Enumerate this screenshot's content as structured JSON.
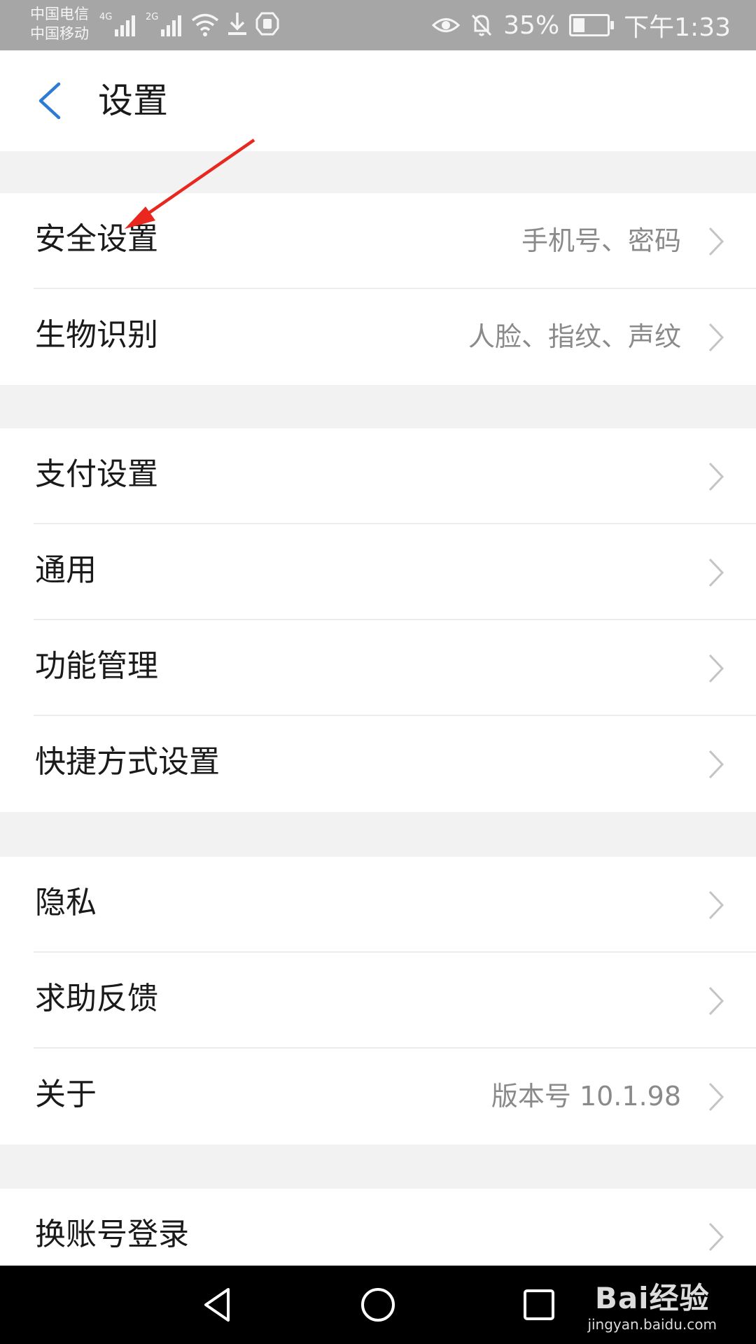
{
  "status_bar": {
    "carrier1": "中国电信",
    "carrier2": "中国移动",
    "net1": "4G",
    "net2": "2G",
    "battery": "35%",
    "battery_level": 0.35,
    "time": "下午1:33",
    "icons": [
      "signal-icon",
      "signal-icon",
      "wifi-icon",
      "download-icon",
      "shield-icon",
      "eye-icon",
      "mute-bell-icon",
      "battery-icon"
    ]
  },
  "header": {
    "title": "设置",
    "back_icon": "back-arrow-icon"
  },
  "groups": [
    {
      "items": [
        {
          "label": "安全设置",
          "value": "手机号、密码"
        },
        {
          "label": "生物识别",
          "value": "人脸、指纹、声纹"
        }
      ]
    },
    {
      "items": [
        {
          "label": "支付设置",
          "value": ""
        },
        {
          "label": "通用",
          "value": ""
        },
        {
          "label": "功能管理",
          "value": ""
        },
        {
          "label": "快捷方式设置",
          "value": ""
        }
      ]
    },
    {
      "items": [
        {
          "label": "隐私",
          "value": ""
        },
        {
          "label": "求助反馈",
          "value": ""
        },
        {
          "label": "关于",
          "value": "版本号 10.1.98"
        }
      ]
    },
    {
      "items": [
        {
          "label": "换账号登录",
          "value": ""
        }
      ]
    }
  ],
  "nav_bar": {
    "buttons": [
      "back-triangle-icon",
      "home-circle-icon",
      "recents-square-icon"
    ]
  },
  "watermark": {
    "logo": "Bai经验",
    "url": "jingyan.baidu.com"
  },
  "colors": {
    "accent": "#2e7bd6",
    "annotation": "#e8281f",
    "statusbar": "#a6a6a6"
  }
}
